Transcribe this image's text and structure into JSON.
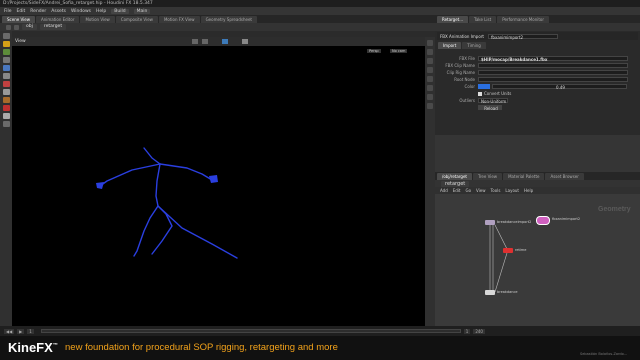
{
  "window": {
    "title": "D:/Projects/SideFX/Andrei_Sofia_retarget.hip - Houdini FX 18.5.347"
  },
  "menubar": {
    "items": [
      "File",
      "Edit",
      "Render",
      "Assets",
      "Windows",
      "Help"
    ],
    "build_label": "Build",
    "main_label": "Main"
  },
  "left_tabs": [
    "Scene View",
    "Animation Editor",
    "Motion View",
    "Composite View",
    "Motion FX View",
    "Geometry Spreadsheet"
  ],
  "viewport": {
    "path": "obj",
    "node": "retarget",
    "view_label": "View",
    "persp_label": "Persp",
    "cam_label": "No cam"
  },
  "right_tabs": [
    "Retarget...",
    "Take List",
    "Performance Monitor"
  ],
  "params": {
    "node_type": "FBX Animation Import",
    "node_name": "fbxanimimport2",
    "tabs": [
      "Import",
      "Timing"
    ],
    "rows": [
      {
        "label": "FBX File",
        "value": "$HIP/mocap/Breakdance1.fbx"
      },
      {
        "label": "FBX Clip Name",
        "value": ""
      },
      {
        "label": "Clip Rig Name",
        "value": ""
      },
      {
        "label": "Root Node",
        "value": ""
      },
      {
        "label": "Color",
        "value": "0.49"
      },
      {
        "label": "Outliers",
        "value": "Non-Uniform"
      }
    ],
    "convert_units": "Convert Units",
    "reload_label": "Reload"
  },
  "network": {
    "tabs": [
      "/obj/retarget",
      "Tree View",
      "Material Palette",
      "Asset Browser"
    ],
    "path": "retarget",
    "menu": [
      "Add",
      "Edit",
      "Go",
      "View",
      "Tools",
      "Layout",
      "Help"
    ],
    "context_label": "Geometry",
    "nodes": [
      {
        "label": "breakdanceimport2"
      },
      {
        "label": "fbxanimimport2"
      },
      {
        "label": "retime"
      },
      {
        "label": "breakdance"
      }
    ]
  },
  "timeline": {
    "frame": "1",
    "start": "1",
    "end": "240"
  },
  "banner": {
    "logo": "KineFX",
    "trademark": "™",
    "tagline": "new foundation for procedural SOP rigging, retargeting and more",
    "credit": "Sebastián Bolaños-Zardo..."
  },
  "colors": {
    "skeleton": "#2a3fe0",
    "accent": "#f2a21b",
    "node_selected": "#d060c0",
    "node_red": "#e03030"
  }
}
